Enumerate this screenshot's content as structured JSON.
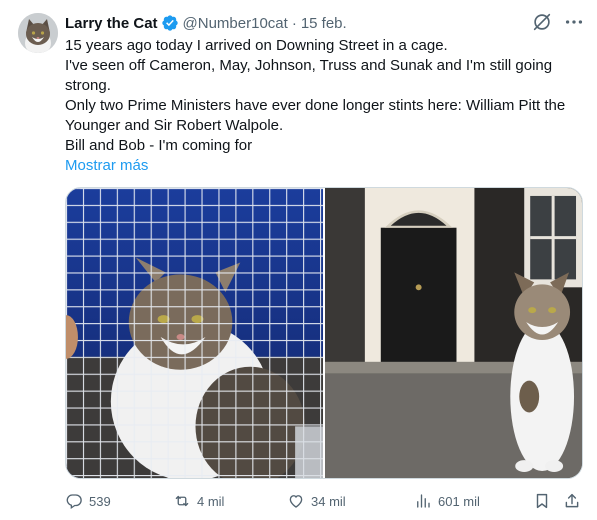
{
  "tweet": {
    "author_name": "Larry the Cat",
    "handle": "@Number10cat",
    "separator": "·",
    "date": "15 feb.",
    "lines": [
      "15 years ago today I arrived on Downing Street in a cage.",
      "I've seen off Cameron, May, Johnson, Truss and Sunak and I'm still going strong.",
      "Only two Prime Ministers have ever done longer stints here: William Pitt the Younger and Sir Robert Walpole.",
      "Bill and Bob - I'm coming for"
    ],
    "show_more": "Mostrar más"
  },
  "media": [
    {
      "icon": "cat-in-cage-photo"
    },
    {
      "icon": "cat-at-downing-street-photo"
    }
  ],
  "actions": {
    "replies": "539",
    "retweets": "4 mil",
    "likes": "34 mil",
    "views": "601 mil"
  },
  "colors": {
    "verified": "#1d9bf0",
    "link": "#1d9bf0",
    "muted": "#536471"
  }
}
